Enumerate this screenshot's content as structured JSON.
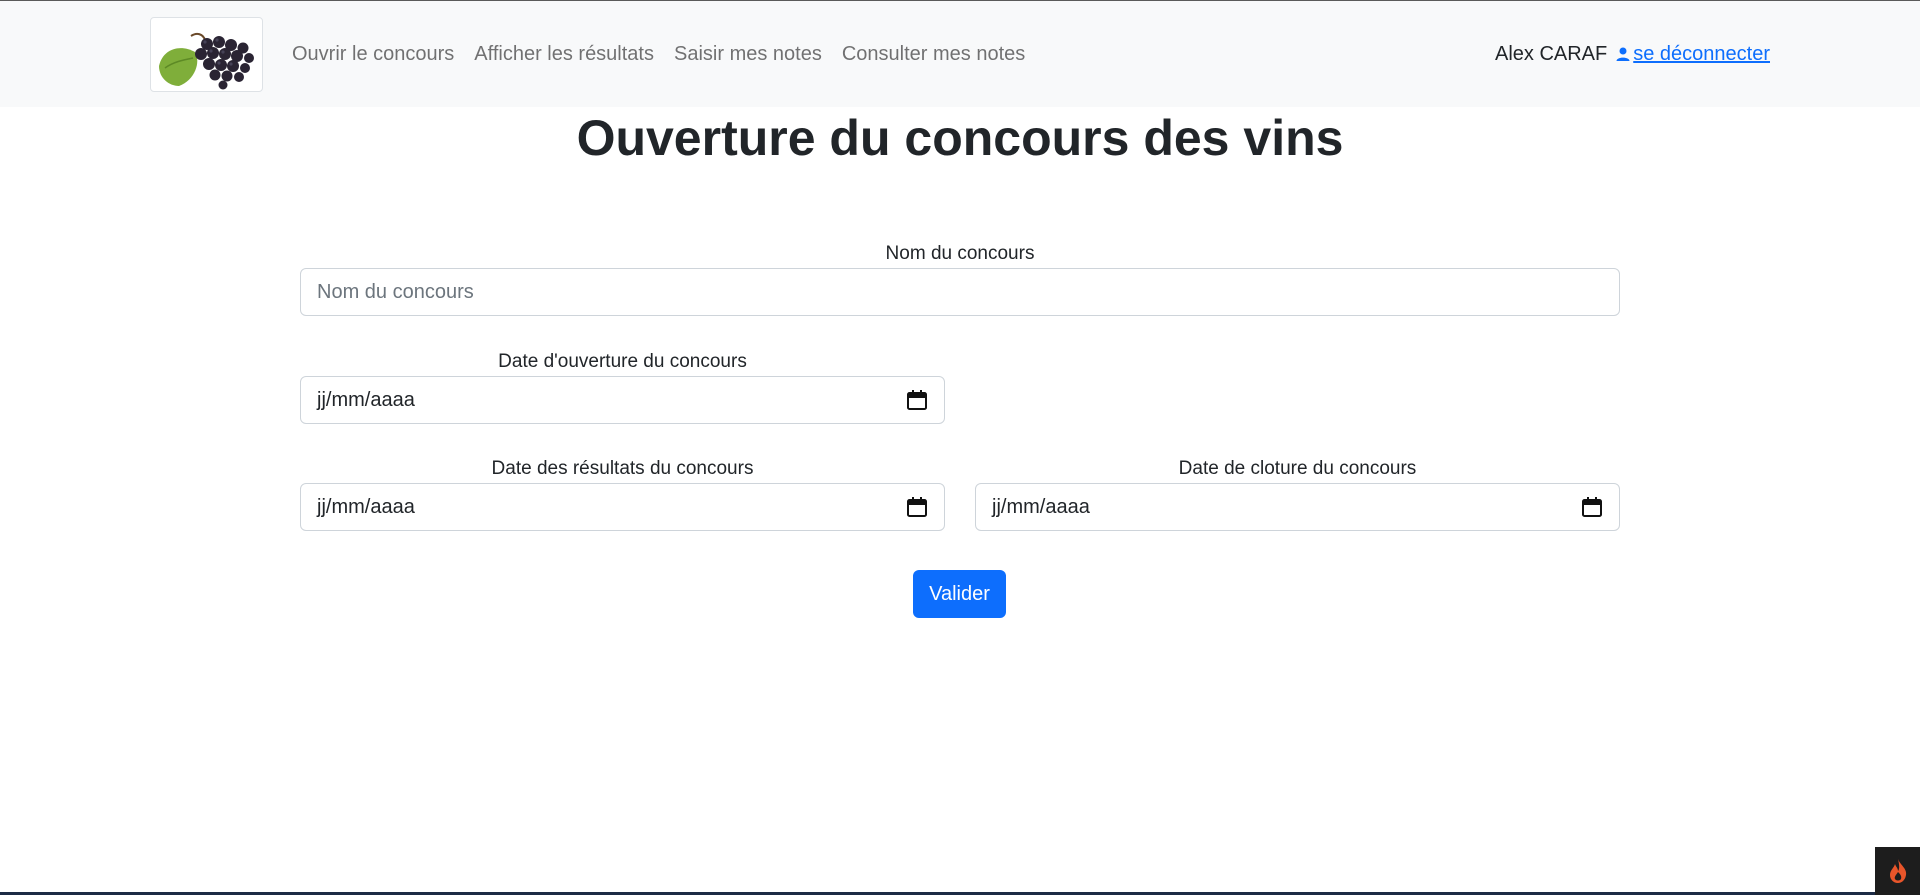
{
  "navbar": {
    "logo_alt": "grapes-logo",
    "links": [
      "Ouvrir le concours",
      "Afficher les résultats",
      "Saisir mes notes",
      "Consulter mes notes"
    ],
    "user_name": "Alex CARAF",
    "logout_label": "se déconnecter"
  },
  "page": {
    "title": "Ouverture du concours des vins"
  },
  "form": {
    "name": {
      "label": "Nom du concours",
      "placeholder": "Nom du concours",
      "value": ""
    },
    "opening_date": {
      "label": "Date d'ouverture du concours",
      "value": "jj/mm/aaaa"
    },
    "results_date": {
      "label": "Date des résultats du concours",
      "value": "jj/mm/aaaa"
    },
    "closing_date": {
      "label": "Date de cloture du concours",
      "value": "jj/mm/aaaa"
    },
    "submit_label": "Valider"
  },
  "icons": {
    "user": "person-icon",
    "calendar": "calendar-icon",
    "tray": "flame-icon"
  },
  "colors": {
    "primary": "#0d6efd",
    "navbar_bg": "#f8f9fa",
    "text": "#212529"
  }
}
